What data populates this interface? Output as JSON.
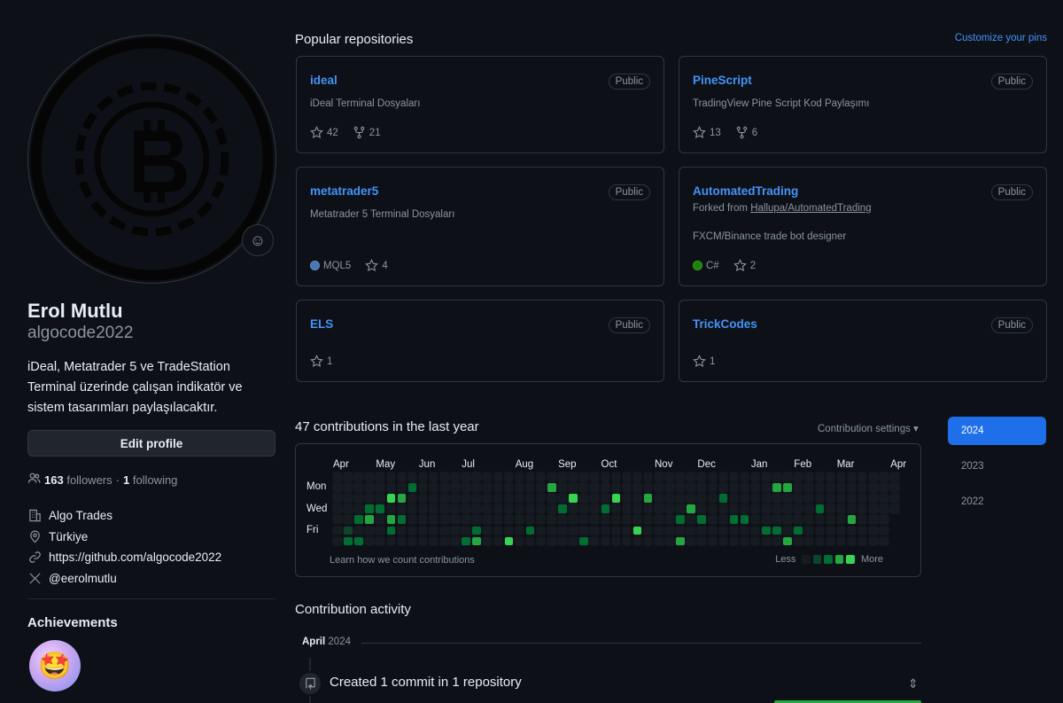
{
  "profile": {
    "name": "Erol Mutlu",
    "login": "algocode2022",
    "bio": "iDeal, Metatrader 5 ve TradeStation Terminal üzerinde çalışan indikatör ve sistem tasarımları paylaşılacaktır.",
    "edit_label": "Edit profile",
    "followers_count": "163",
    "followers_label": "followers",
    "following_count": "1",
    "following_label": "following",
    "company": "Algo Trades",
    "location": "Türkiye",
    "website": "https://github.com/algocode2022",
    "twitter": "@eerolmutlu",
    "achievements_title": "Achievements"
  },
  "pinned": {
    "title": "Popular repositories",
    "customize_label": "Customize your pins",
    "repos": [
      {
        "name": "ideal",
        "visibility": "Public",
        "description": "iDeal Terminal Dosyaları",
        "stars": "42",
        "forks": "21"
      },
      {
        "name": "PineScript",
        "visibility": "Public",
        "description": "TradingView Pine Script Kod Paylaşımı",
        "stars": "13",
        "forks": "6"
      },
      {
        "name": "metatrader5",
        "visibility": "Public",
        "description": "Metatrader 5 Terminal Dosyaları",
        "language": "MQL5",
        "language_color": "#4a76b8",
        "stars": "4"
      },
      {
        "name": "AutomatedTrading",
        "visibility": "Public",
        "fork_prefix": "Forked from ",
        "fork_source": "Hallupa/AutomatedTrading",
        "description": "FXCM/Binance trade bot designer",
        "language": "C#",
        "language_color": "#178600",
        "stars": "2"
      },
      {
        "name": "ELS",
        "visibility": "Public",
        "stars": "1"
      },
      {
        "name": "TrickCodes",
        "visibility": "Public",
        "stars": "1"
      }
    ]
  },
  "contributions": {
    "title": "47 contributions in the last year",
    "settings_label": "Contribution settings ▾",
    "months": [
      "Apr",
      "May",
      "Jun",
      "Jul",
      "Aug",
      "Sep",
      "Oct",
      "Nov",
      "Dec",
      "Jan",
      "Feb",
      "Mar",
      "Apr"
    ],
    "day_labels": [
      "Mon",
      "Wed",
      "Fri"
    ],
    "learn_label": "Learn how we count contributions",
    "less_label": "Less",
    "more_label": "More",
    "active_cells": [
      [
        1,
        5,
        1
      ],
      [
        1,
        6,
        2
      ],
      [
        2,
        4,
        2
      ],
      [
        2,
        6,
        2
      ],
      [
        3,
        3,
        2
      ],
      [
        3,
        4,
        3
      ],
      [
        4,
        3,
        2
      ],
      [
        5,
        2,
        4
      ],
      [
        5,
        4,
        3
      ],
      [
        5,
        5,
        2
      ],
      [
        6,
        2,
        3
      ],
      [
        6,
        4,
        2
      ],
      [
        7,
        1,
        2
      ],
      [
        12,
        6,
        2
      ],
      [
        13,
        5,
        2
      ],
      [
        13,
        6,
        3
      ],
      [
        16,
        6,
        4
      ],
      [
        18,
        5,
        2
      ],
      [
        20,
        1,
        3
      ],
      [
        21,
        3,
        2
      ],
      [
        22,
        2,
        4
      ],
      [
        23,
        6,
        2
      ],
      [
        25,
        3,
        2
      ],
      [
        26,
        2,
        4
      ],
      [
        28,
        5,
        4
      ],
      [
        29,
        2,
        3
      ],
      [
        32,
        4,
        2
      ],
      [
        32,
        6,
        3
      ],
      [
        33,
        3,
        3
      ],
      [
        34,
        4,
        2
      ],
      [
        36,
        2,
        2
      ],
      [
        37,
        4,
        2
      ],
      [
        38,
        4,
        2
      ],
      [
        40,
        5,
        2
      ],
      [
        41,
        1,
        3
      ],
      [
        42,
        1,
        3
      ],
      [
        41,
        5,
        2
      ],
      [
        42,
        6,
        3
      ],
      [
        43,
        5,
        2
      ],
      [
        45,
        3,
        2
      ],
      [
        48,
        4,
        3
      ]
    ],
    "years": [
      "2024",
      "2023",
      "2022"
    ]
  },
  "activity": {
    "title": "Contribution activity",
    "month": "April",
    "year": "2024",
    "item_text": "Created 1 commit in 1 repository"
  }
}
